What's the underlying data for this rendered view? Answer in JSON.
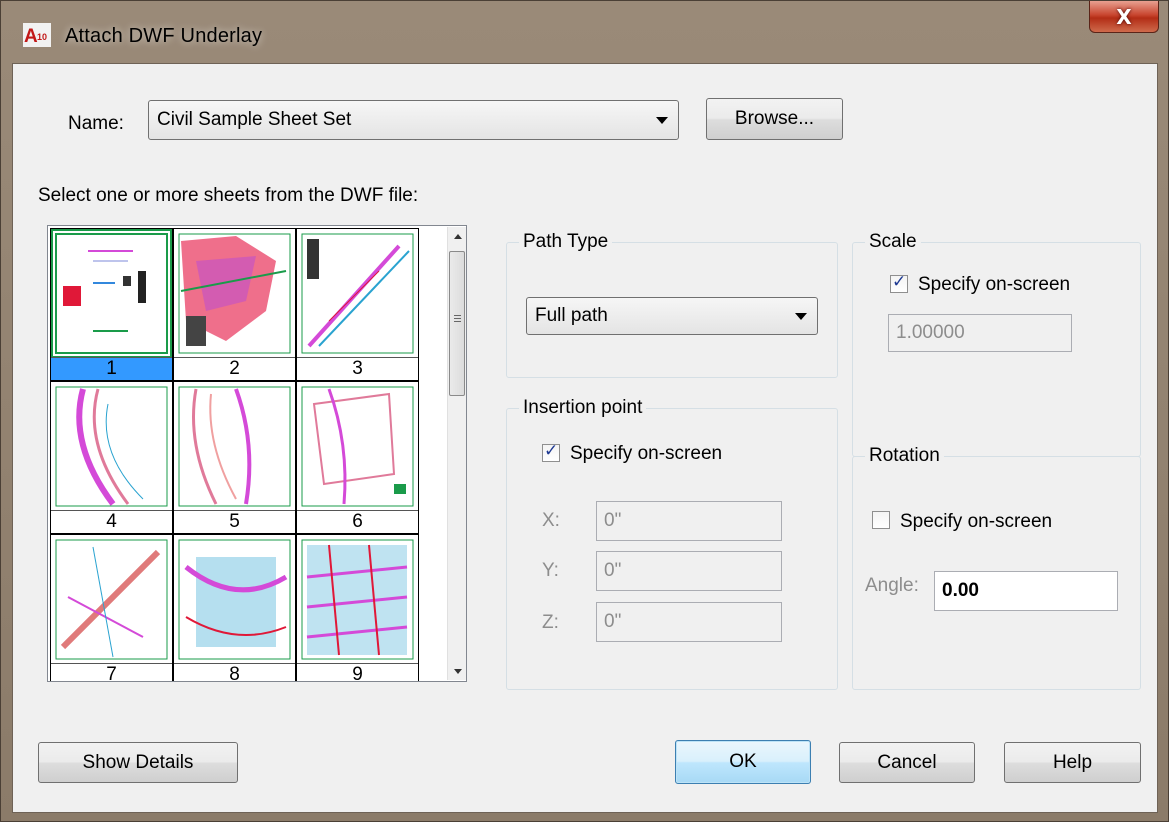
{
  "window": {
    "title": "Attach DWF Underlay",
    "close_glyph": "X"
  },
  "name_row": {
    "label": "Name:",
    "value": "Civil Sample Sheet Set",
    "browse_label": "Browse..."
  },
  "sheets": {
    "prompt": "Select one or more sheets from the DWF file:",
    "items": [
      "1",
      "2",
      "3",
      "4",
      "5",
      "6",
      "7",
      "8",
      "9"
    ],
    "selected": "1"
  },
  "path_type": {
    "title": "Path Type",
    "value": "Full path"
  },
  "insertion_point": {
    "title": "Insertion point",
    "specify_label": "Specify on-screen",
    "specify_checked": true,
    "x_label": "X:",
    "x_value": "0\"",
    "y_label": "Y:",
    "y_value": "0\"",
    "z_label": "Z:",
    "z_value": "0\""
  },
  "scale": {
    "title": "Scale",
    "specify_label": "Specify on-screen",
    "specify_checked": true,
    "value": "1.00000"
  },
  "rotation": {
    "title": "Rotation",
    "specify_label": "Specify on-screen",
    "specify_checked": false,
    "angle_label": "Angle:",
    "angle_value": "0.00"
  },
  "buttons": {
    "show_details": "Show Details",
    "ok": "OK",
    "cancel": "Cancel",
    "help": "Help"
  },
  "colors": {
    "selection": "#3399ff",
    "title_bar": "#9a8a78",
    "close": "#c8452f"
  }
}
